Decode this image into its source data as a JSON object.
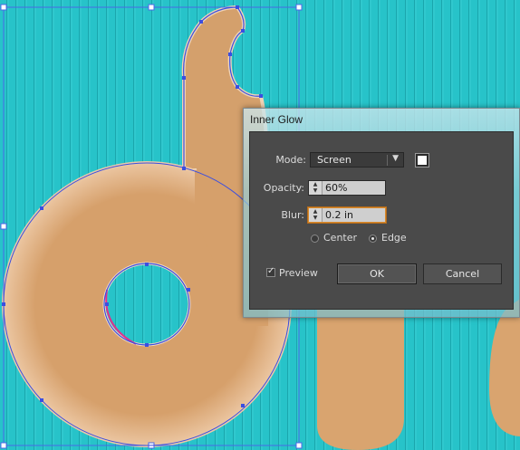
{
  "dialog": {
    "title": "Inner Glow",
    "mode_label": "Mode:",
    "mode_value": "Screen",
    "glow_color": "#ffffff",
    "opacity_label": "Opacity:",
    "opacity_value": "60%",
    "blur_label": "Blur:",
    "blur_value": "0.2 in",
    "center_label": "Center",
    "edge_label": "Edge",
    "selected_source": "Edge",
    "preview_label": "Preview",
    "preview_checked": true,
    "ok_label": "OK",
    "cancel_label": "Cancel"
  },
  "colors": {
    "canvas": "#25c0c6",
    "shape_fill": "#d9a46f",
    "selection": "#3b4fe0",
    "dialog_body": "#4a4a4a",
    "focus_ring": "#d98a2b"
  },
  "icons": {
    "dropdown": "triangle-down-icon",
    "spinner": "up-down-arrows-icon",
    "check": "check-mark-icon"
  }
}
